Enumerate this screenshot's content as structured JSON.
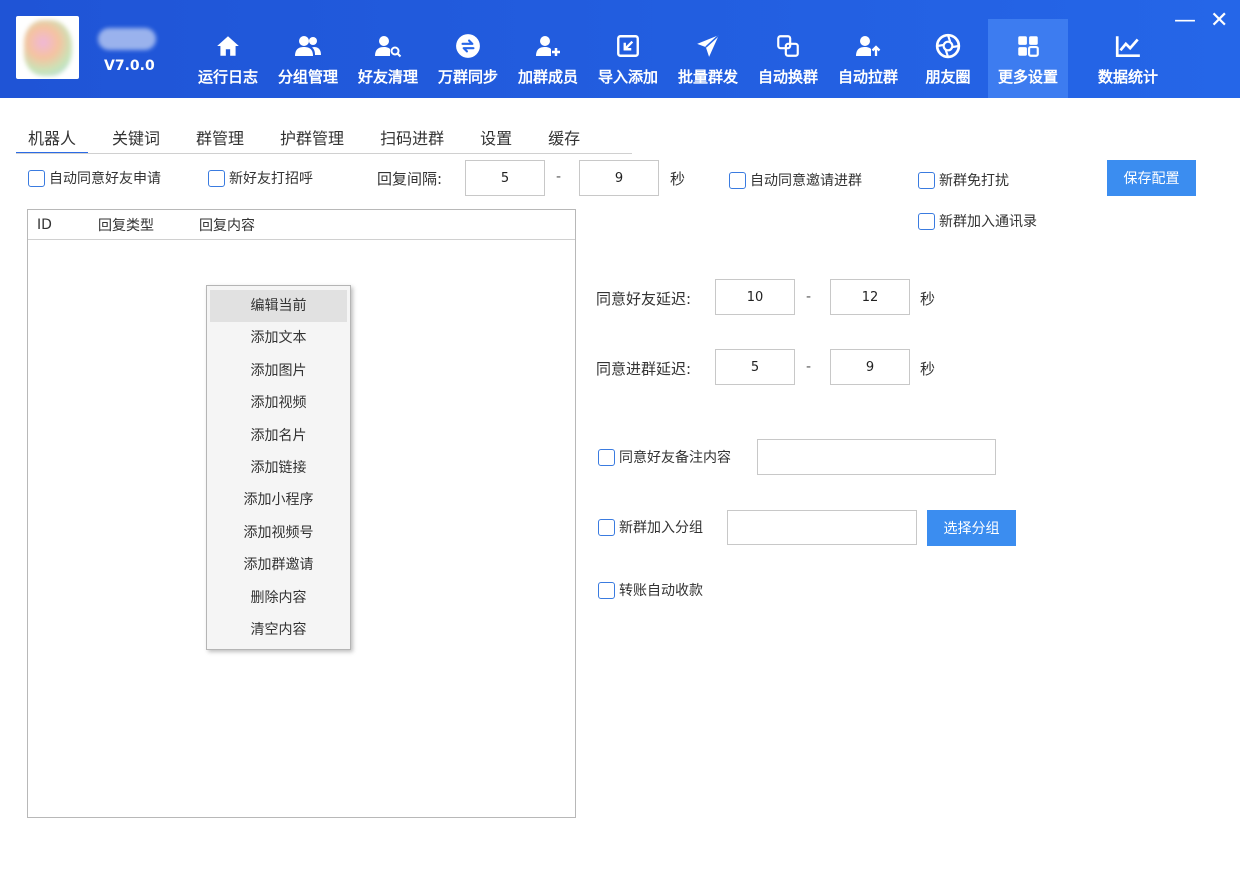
{
  "app": {
    "version": "V7.0.0"
  },
  "nav": [
    {
      "label": "运行日志",
      "icon": "home-icon"
    },
    {
      "label": "分组管理",
      "icon": "users-icon"
    },
    {
      "label": "好友清理",
      "icon": "user-search-icon"
    },
    {
      "label": "万群同步",
      "icon": "sync-icon"
    },
    {
      "label": "加群成员",
      "icon": "user-add-icon"
    },
    {
      "label": "导入添加",
      "icon": "import-icon"
    },
    {
      "label": "批量群发",
      "icon": "send-icon"
    },
    {
      "label": "自动换群",
      "icon": "swap-icon"
    },
    {
      "label": "自动拉群",
      "icon": "user-up-icon"
    },
    {
      "label": "朋友圈",
      "icon": "aperture-icon"
    },
    {
      "label": "更多设置",
      "icon": "grid-icon"
    },
    {
      "label": "数据统计",
      "icon": "chart-icon"
    }
  ],
  "window": {
    "minimize": "—",
    "close": "✕"
  },
  "tabs": [
    "机器人",
    "关键词",
    "群管理",
    "护群管理",
    "扫码进群",
    "设置",
    "缓存"
  ],
  "settings": {
    "auto_accept_friend": "自动同意好友申请",
    "greet_new_friend": "新好友打招呼",
    "reply_interval_label": "回复间隔:",
    "reply_min": "5",
    "reply_max": "9",
    "dash": "-",
    "seconds": "秒",
    "auto_accept_group_invite": "自动同意邀请进群",
    "new_group_mute": "新群免打扰",
    "save_config": "保存配置",
    "new_group_contacts": "新群加入通讯录",
    "friend_delay_label": "同意好友延迟:",
    "friend_delay_min": "10",
    "friend_delay_max": "12",
    "group_delay_label": "同意进群延迟:",
    "group_delay_min": "5",
    "group_delay_max": "9",
    "friend_remark": "同意好友备注内容",
    "friend_remark_value": "",
    "new_group_join_group": "新群加入分组",
    "group_name_value": "",
    "select_group": "选择分组",
    "auto_receive_transfer": "转账自动收款"
  },
  "table": {
    "headers": [
      "ID",
      "回复类型",
      "回复内容"
    ]
  },
  "context_menu": [
    "编辑当前",
    "添加文本",
    "添加图片",
    "添加视频",
    "添加名片",
    "添加链接",
    "添加小程序",
    "添加视频号",
    "添加群邀请",
    "删除内容",
    "清空内容"
  ]
}
